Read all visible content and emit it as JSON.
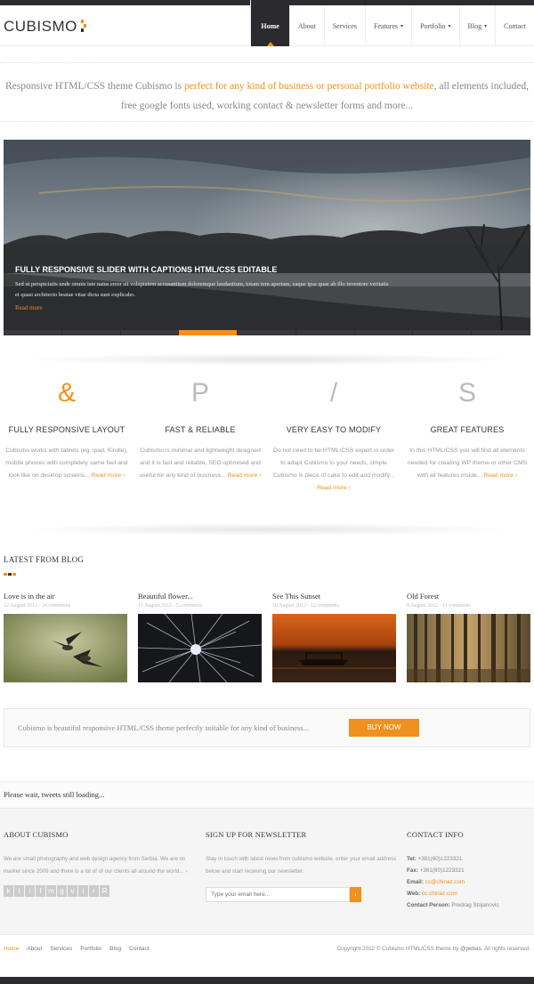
{
  "brand": {
    "logo_text": "CUBISMO",
    "accent": "#f0901e",
    "dark": "#2b2b2f"
  },
  "nav": {
    "items": [
      {
        "label": "Home",
        "active": true
      },
      {
        "label": "About"
      },
      {
        "label": "Services"
      },
      {
        "label": "Features",
        "caret": "▾"
      },
      {
        "label": "Portfolio",
        "caret": "▾"
      },
      {
        "label": "Blog",
        "caret": "▾"
      },
      {
        "label": "Contact"
      }
    ]
  },
  "intro": {
    "text_before": "Responsive HTML/CSS theme Cubismo is ",
    "highlight": "perfect for any kind of business or personal portfolio website",
    "text_after": ", all elements included, free google fonts used, working contact & newsletter forms and more..."
  },
  "slider": {
    "title": "FULLY RESPONSIVE SLIDER WITH CAPTIONS HTML/CSS EDITABLE",
    "text": "Sed ut perspiciatis unde omnis iste natus error sit voluptatem accusantium doloremque laudantium, totam rem aperiam, eaque ipsa quae ab illo inventore veritatis et quasi architecto beatae vitae dicta sunt explicabo.",
    "link": "Read more"
  },
  "features": [
    {
      "icon": "&",
      "title": "FULLY RESPONSIVE LAYOUT",
      "text": "Cubismo works with tablets (eg. ipad, Kindle), mobile phones with completely same feel and look like on desktop screens... ",
      "link": "Read more ›"
    },
    {
      "icon": "P",
      "title": "FAST & RELIABLE",
      "text": "Cubismo is minimal and lightweight designed and it is fast and reliable, SEO optimised and useful for any kind of business... ",
      "link": "Read more ›"
    },
    {
      "icon": "/",
      "title": "VERY EASY TO MODIFY",
      "text": "Do not need to be HTML/CSS expert in order to adapt Cubismo to your needs, simple Cubismo is piece of cake to edit and modify... ",
      "link": "Read more ›"
    },
    {
      "icon": "S",
      "title": "GREAT FEATURES",
      "text": "In this HTML/CSS you will find all elements needed for creating WP theme or other CMS with all features inside... ",
      "link": "Read more ›"
    }
  ],
  "blog": {
    "title": "LATEST FROM BLOG",
    "posts": [
      {
        "title": "Love is in the air",
        "meta": "12 August 2012 - 24 comments"
      },
      {
        "title": "Beautiful flower...",
        "meta": "11 August 2012 - 5 comments"
      },
      {
        "title": "See This Sunset",
        "meta": "10 August 2012 - 12 comments"
      },
      {
        "title": "Old Forest",
        "meta": "9 August 2012 - 11 comments"
      }
    ]
  },
  "cta": {
    "text": "Cubismo is beautiful responsive HTML/CSS theme perfectly suitable for any kind of business...",
    "button": "BUY NOW"
  },
  "tweets": {
    "text": "Please wait, tweets still loading..."
  },
  "footer": {
    "about": {
      "title": "ABOUT CUBISMO",
      "text": "We are small photography and web design agency from Serbia. We are on market since 2009 and there is a lot of of our clients all around the world...",
      "more": "›",
      "social": [
        "k",
        "l",
        "i",
        "f",
        "m",
        "g",
        "v",
        "i",
        "r",
        "R"
      ]
    },
    "newsletter": {
      "title": "SIGN UP FOR NEWSLETTER",
      "text": "Stay in touch with latest news from cubismo website, enter your email address below and start receiving our newsletter.",
      "placeholder": "Type your email here...",
      "submit": "›"
    },
    "contact": {
      "title": "CONTACT INFO",
      "tel_label": "Tel:",
      "tel": "+381(60)1223321",
      "fax_label": "Fax:",
      "fax": "+381(60)1223321",
      "email_label": "Email:",
      "email": "cc@chinaz.com",
      "web_label": "Web:",
      "web": "cc.chinaz.com",
      "person_label": "Contact Person:",
      "person": "Predrag Stojanovic"
    }
  },
  "bottom": {
    "links": [
      "Home",
      "About",
      "Services",
      "Portfolio",
      "Blog",
      "Contact"
    ],
    "copyright_before": "Copyright 2012 © Cubismo HTML/CSS theme by ",
    "copyright_author": "@pebas",
    "copyright_after": ". All rights reserved."
  }
}
